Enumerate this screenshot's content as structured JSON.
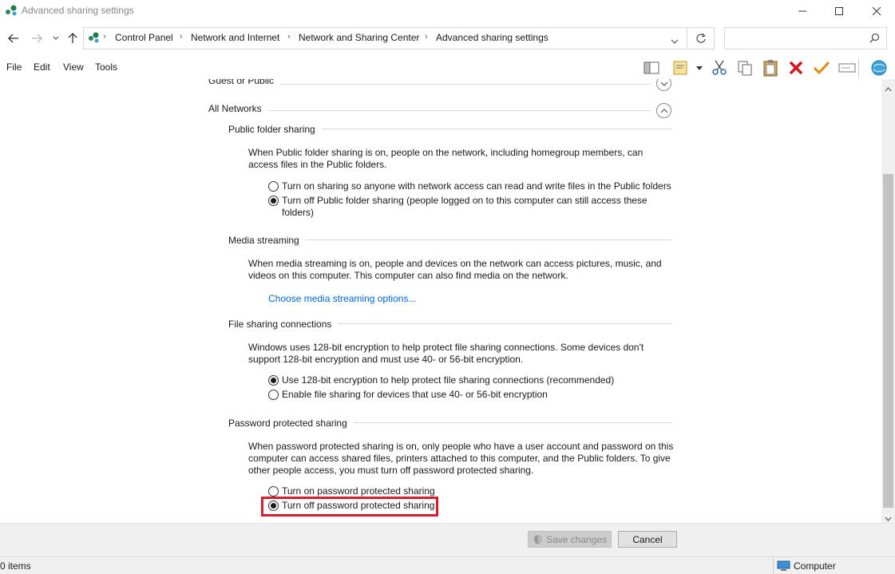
{
  "window": {
    "title": "Advanced sharing settings",
    "controls": {
      "minimize": "—",
      "maximize": "☐",
      "close": "✕"
    }
  },
  "address": {
    "crumbs": [
      "Control Panel",
      "Network and Internet",
      "Network and Sharing Center",
      "Advanced sharing settings"
    ],
    "search_placeholder": ""
  },
  "menu": [
    "File",
    "Edit",
    "View",
    "Tools"
  ],
  "sections": {
    "guest_public": {
      "title": "Guest or Public"
    },
    "all_networks": {
      "title": "All Networks"
    },
    "public_folder": {
      "title": "Public folder sharing",
      "desc": [
        "When Public folder sharing is on, people on the network, including homegroup members, can",
        "access files in the Public folders."
      ],
      "options": [
        {
          "label": "Turn on sharing so anyone with network access can read and write files in the Public folders",
          "checked": false
        },
        {
          "label": "Turn off Public folder sharing (people logged on to this computer can still access these",
          "label2": "folders)",
          "checked": true
        }
      ]
    },
    "media_streaming": {
      "title": "Media streaming",
      "desc": [
        "When media streaming is on, people and devices on the network can access pictures, music, and",
        "videos on this computer. This computer can also find media on the network."
      ],
      "link": "Choose media streaming options..."
    },
    "file_sharing": {
      "title": "File sharing connections",
      "desc": [
        "Windows uses 128-bit encryption to help protect file sharing connections. Some devices don't",
        "support 128-bit encryption and must use 40- or 56-bit encryption."
      ],
      "options": [
        {
          "label": "Use 128-bit encryption to help protect file sharing connections (recommended)",
          "checked": true
        },
        {
          "label": "Enable file sharing for devices that use 40- or 56-bit encryption",
          "checked": false
        }
      ]
    },
    "password_sharing": {
      "title": "Password protected sharing",
      "desc": [
        "When password protected sharing is on, only people who have a user account and password on this",
        "computer can access shared files, printers attached to this computer, and the Public folders. To give",
        "other people access, you must turn off password protected sharing."
      ],
      "options": [
        {
          "label": "Turn on password protected sharing",
          "checked": false
        },
        {
          "label": "Turn off password protected sharing",
          "checked": true
        }
      ]
    }
  },
  "buttons": {
    "save": "Save changes",
    "cancel": "Cancel"
  },
  "status": {
    "items": "0 items",
    "location": "Computer"
  },
  "colors": {
    "highlight": "#d31f2b",
    "link": "#0066cc"
  }
}
